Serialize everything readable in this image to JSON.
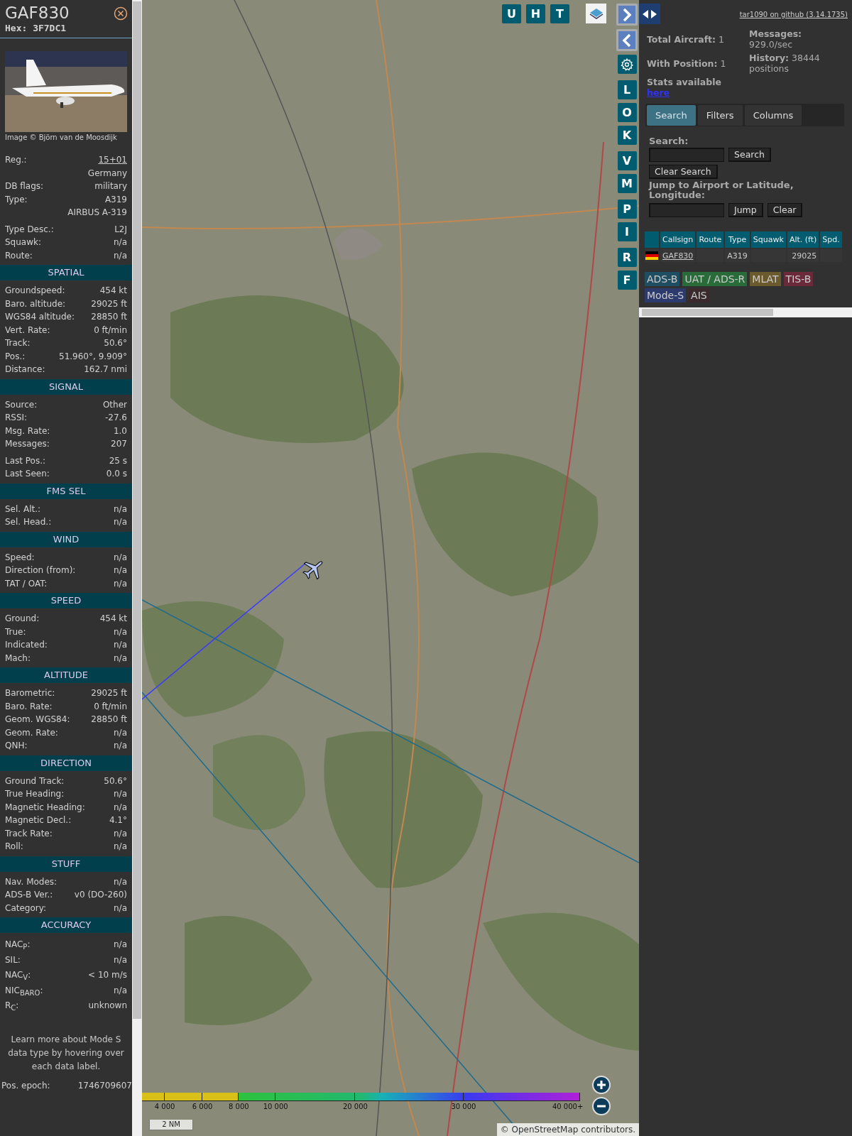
{
  "aircraft": {
    "callsign": "GAF830",
    "hex": "Hex: 3F7DC1",
    "photo_credit": "Image © Björn van de Moosdijk"
  },
  "sections": [
    {
      "groups": [
        [
          {
            "label": "Reg.:",
            "value": "15+01",
            "link": true
          },
          {
            "value": "Germany"
          },
          {
            "label": "DB flags:",
            "value": "military"
          },
          {
            "label": "Type:",
            "value": "A319"
          },
          {
            "value": "AIRBUS A-319"
          }
        ],
        [
          {
            "label": "Type Desc.:",
            "value": "L2J"
          },
          {
            "label": "Squawk:",
            "value": "n/a"
          },
          {
            "label": "Route:",
            "value": "n/a"
          }
        ]
      ]
    },
    {
      "title": "SPATIAL",
      "groups": [
        [
          {
            "label": "Groundspeed:",
            "value": "454 kt"
          },
          {
            "label": "Baro. altitude:",
            "value": "29025 ft"
          },
          {
            "label": "WGS84 altitude:",
            "value": "28850 ft"
          },
          {
            "label": "Vert. Rate:",
            "value": "0 ft/min"
          },
          {
            "label": "Track:",
            "value": "50.6°"
          },
          {
            "label": "Pos.:",
            "value": "51.960°, 9.909°"
          },
          {
            "label": "Distance:",
            "value": "162.7 nmi"
          }
        ]
      ]
    },
    {
      "title": "SIGNAL",
      "groups": [
        [
          {
            "label": "Source:",
            "value": "Other"
          },
          {
            "label": "RSSI:",
            "value": "-27.6"
          },
          {
            "label": "Msg. Rate:",
            "value": "1.0"
          },
          {
            "label": "Messages:",
            "value": "207"
          }
        ],
        [
          {
            "label": "Last Pos.:",
            "value": "25 s"
          },
          {
            "label": "Last Seen:",
            "value": "0.0 s"
          }
        ]
      ]
    },
    {
      "title": "FMS SEL",
      "groups": [
        [
          {
            "label": "Sel. Alt.:",
            "value": "n/a"
          },
          {
            "label": "Sel. Head.:",
            "value": "n/a"
          }
        ]
      ]
    },
    {
      "title": "WIND",
      "groups": [
        [
          {
            "label": "Speed:",
            "value": "n/a"
          },
          {
            "label": "Direction (from):",
            "value": "n/a"
          },
          {
            "label": "TAT / OAT:",
            "value": "n/a"
          }
        ]
      ]
    },
    {
      "title": "SPEED",
      "groups": [
        [
          {
            "label": "Ground:",
            "value": "454 kt"
          },
          {
            "label": "True:",
            "value": "n/a"
          },
          {
            "label": "Indicated:",
            "value": "n/a"
          },
          {
            "label": "Mach:",
            "value": "n/a"
          }
        ]
      ]
    },
    {
      "title": "ALTITUDE",
      "groups": [
        [
          {
            "label": "Barometric:",
            "value": "29025 ft"
          },
          {
            "label": "Baro. Rate:",
            "value": "0 ft/min"
          },
          {
            "label": "Geom. WGS84:",
            "value": "28850 ft"
          },
          {
            "label": "Geom. Rate:",
            "value": "n/a"
          },
          {
            "label": "QNH:",
            "value": "n/a"
          }
        ]
      ]
    },
    {
      "title": "DIRECTION",
      "groups": [
        [
          {
            "label": "Ground Track:",
            "value": "50.6°"
          },
          {
            "label": "True Heading:",
            "value": "n/a"
          },
          {
            "label": "Magnetic Heading:",
            "value": "n/a"
          },
          {
            "label": "Magnetic Decl.:",
            "value": "4.1°"
          },
          {
            "label": "Track Rate:",
            "value": "n/a"
          },
          {
            "label": "Roll:",
            "value": "n/a"
          }
        ]
      ]
    },
    {
      "title": "STUFF",
      "groups": [
        [
          {
            "label": "Nav. Modes:",
            "value": "n/a"
          },
          {
            "label": "ADS-B Ver.:",
            "value": "v0 (DO-260)"
          },
          {
            "label": "Category:",
            "value": "n/a"
          }
        ]
      ]
    },
    {
      "title": "ACCURACY",
      "groups": [
        [
          {
            "label": "NAC$_{P}$:",
            "value": "n/a"
          },
          {
            "label": "SIL:",
            "value": "n/a"
          },
          {
            "label": "NAC$_{V}$:",
            "value": "< 10 m/s"
          },
          {
            "label": "NIC$_{BARO}$:",
            "value": "n/a"
          },
          {
            "label": "R$_{C}$:",
            "value": "unknown"
          }
        ]
      ]
    }
  ],
  "note": "Learn more about Mode S data type by hovering over each data label.",
  "epoch": {
    "label": "Pos. epoch:",
    "value": "1746709607"
  },
  "map": {
    "top_buttons": [
      "U",
      "H",
      "T"
    ],
    "side_buttons": [
      [
        "L",
        "O",
        "K"
      ],
      [
        "V",
        "M"
      ],
      [
        "P",
        "I"
      ],
      [
        "R",
        "F"
      ]
    ],
    "legend": [
      "4 000",
      "6 000",
      "8 000",
      "10 000",
      "20 000",
      "30 000",
      "40 000+"
    ],
    "scale": "2 NM",
    "attribution": {
      "prefix": "©",
      "link": "OpenStreetMap",
      "suffix": "contributors."
    }
  },
  "panel": {
    "github_link": "tar1090 on github (3.14.1735)",
    "stats_left": [
      "**Total Aircraft:** 1",
      "**With Position:** 1"
    ],
    "stats_link": {
      "text": "Stats available",
      "link": "here"
    },
    "stats_right": [
      "**Messages:** 929.0/sec",
      "**History:** 38444 positions"
    ],
    "tabs": [
      {
        "label": "Search",
        "selected": true
      },
      {
        "label": "Filters",
        "selected": false
      },
      {
        "label": "Columns",
        "selected": false
      }
    ],
    "search": {
      "label": "Search:",
      "button": "Search",
      "clear": "Clear Search"
    },
    "jump": {
      "label": "Jump to Airport or Latitude, Longitude:",
      "button": "Jump",
      "clear": "Clear"
    },
    "table": {
      "columns": [
        "Callsign",
        "Route",
        "Type",
        "Squawk",
        "Alt. (ft)",
        "Spd."
      ],
      "rows": [
        {
          "callsign": "GAF830",
          "type": "A319",
          "altitude": "29025"
        }
      ]
    },
    "sources": [
      {
        "label": "ADS-B",
        "color": "#1f4e63"
      },
      {
        "label": "UAT / ADS-R",
        "color": "#2a6b3a"
      },
      {
        "label": "MLAT",
        "color": "#6b5a2e"
      },
      {
        "label": "TIS-B",
        "color": "#6b2a3a"
      },
      {
        "label": "Mode-S",
        "color": "#2c3a6e"
      },
      {
        "label": "AIS",
        "color": "#3a2a2e"
      }
    ]
  }
}
